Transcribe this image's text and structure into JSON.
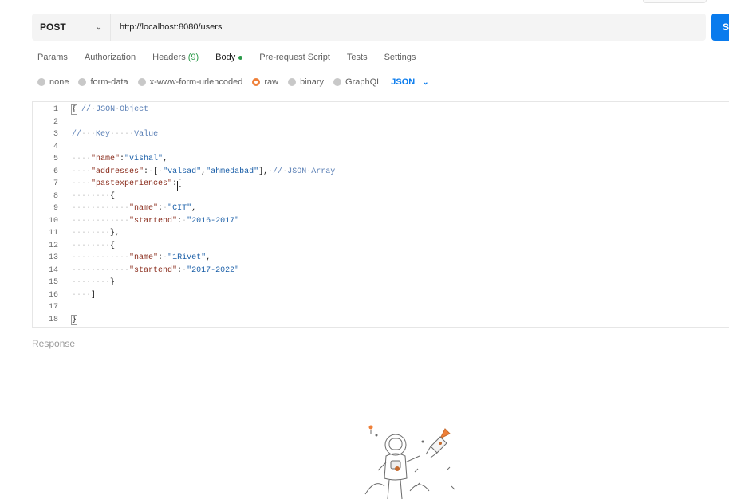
{
  "request": {
    "method": "POST",
    "url": "http://localhost:8080/users",
    "send_label": "S"
  },
  "tabs": [
    {
      "label": "Params"
    },
    {
      "label": "Authorization"
    },
    {
      "label": "Headers",
      "count": "(9)"
    },
    {
      "label": "Body",
      "active": true
    },
    {
      "label": "Pre-request Script"
    },
    {
      "label": "Tests"
    },
    {
      "label": "Settings"
    }
  ],
  "body_types": [
    {
      "label": "none",
      "selected": false
    },
    {
      "label": "form-data",
      "selected": false
    },
    {
      "label": "x-www-form-urlencoded",
      "selected": false
    },
    {
      "label": "raw",
      "selected": true
    },
    {
      "label": "binary",
      "selected": false
    },
    {
      "label": "GraphQL",
      "selected": false
    }
  ],
  "format": "JSON",
  "editor": {
    "line_numbers": [
      "1",
      "2",
      "3",
      "4",
      "5",
      "6",
      "7",
      "8",
      "9",
      "10",
      "11",
      "12",
      "13",
      "14",
      "15",
      "16",
      "17",
      "18"
    ],
    "lines": [
      "{ // JSON Object",
      "",
      "//   Key     Value",
      "",
      "    \"name\":\"vishal\",",
      "    \"addresses\": [ \"valsad\",\"ahmedabad\"], // JSON Array",
      "    \"pastexperiences\":[",
      "        {",
      "            \"name\": \"CIT\",",
      "            \"startend\": \"2016-2017\"",
      "        },",
      "        {",
      "            \"name\": \"1Rivet\",",
      "            \"startend\": \"2017-2022\"",
      "        }",
      "    ]",
      "",
      "}"
    ]
  },
  "response": {
    "label": "Response"
  },
  "colors": {
    "accent": "#097bed",
    "raw_selected": "#ee7f38",
    "modified_dot": "#2c9a4a"
  }
}
